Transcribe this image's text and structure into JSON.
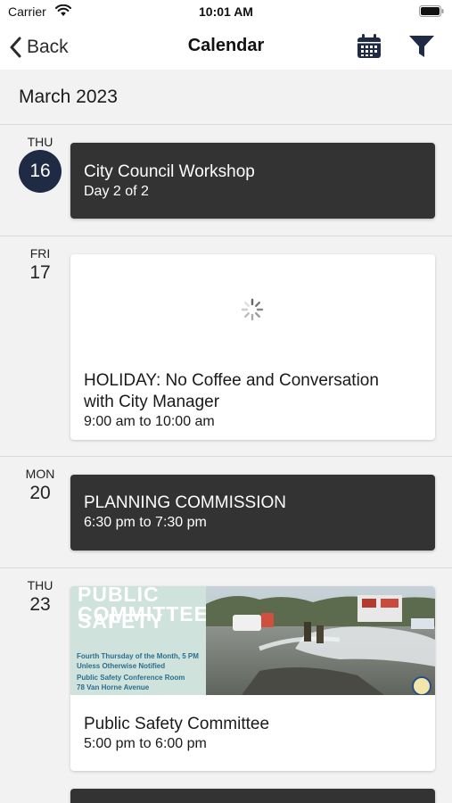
{
  "status_bar": {
    "carrier": "Carrier",
    "time": "10:01 AM"
  },
  "nav": {
    "back_label": "Back",
    "title": "Calendar",
    "calendar_icon": "calendar-icon",
    "filter_icon": "filter-icon"
  },
  "month": "March 2023",
  "days": [
    {
      "weekday": "THU",
      "day": "16",
      "is_today": true,
      "events": [
        {
          "title": "City Council Workshop",
          "subtitle": "Day 2 of 2",
          "style": "dark"
        }
      ]
    },
    {
      "weekday": "FRI",
      "day": "17",
      "events": [
        {
          "title_line1": "HOLIDAY: No Coffee and Conversation",
          "title_line2": "with City Manager",
          "time": "9:00 am to 10:00 am",
          "style": "light",
          "image_state": "loading"
        }
      ]
    },
    {
      "weekday": "MON",
      "day": "20",
      "events": [
        {
          "title": "PLANNING COMMISSION",
          "time": "6:30 pm to 7:30 pm",
          "style": "dark"
        }
      ]
    },
    {
      "weekday": "THU",
      "day": "23",
      "events": [
        {
          "title": "Public Safety Committee",
          "time": "5:00 pm to 6:00 pm",
          "style": "light",
          "poster": {
            "heading_line1": "PUBLIC SAFETY",
            "heading_line2": "COMMITTEE",
            "line1": "Fourth Thursday of the Month, 5 PM",
            "line2": "Unless Otherwise Notified",
            "line3": "Public Safety Conference Room",
            "line4": "78 Van Horne Avenue"
          }
        }
      ]
    }
  ],
  "colors": {
    "accent_dark": "#1f2a44",
    "card_dark": "#333333",
    "background": "#f2f2f2"
  }
}
